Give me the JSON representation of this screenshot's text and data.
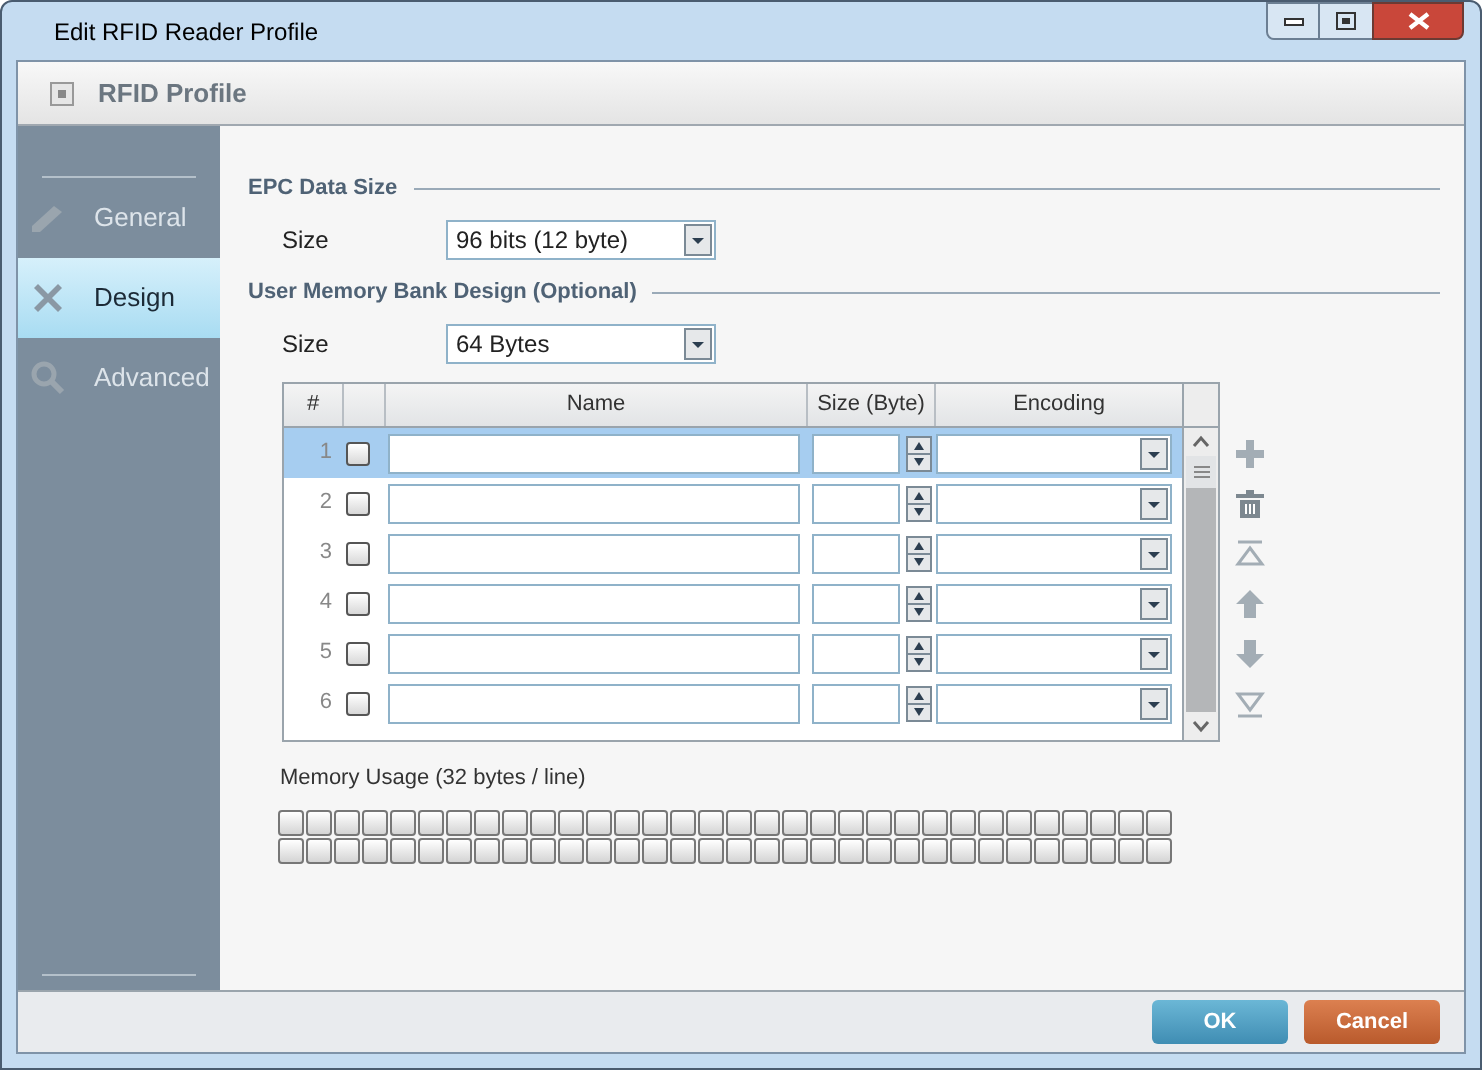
{
  "window": {
    "title": "Edit RFID Reader Profile"
  },
  "header": {
    "title": "RFID Profile"
  },
  "sidebar": {
    "items": [
      {
        "label": "General",
        "selected": false
      },
      {
        "label": "Design",
        "selected": true
      },
      {
        "label": "Advanced",
        "selected": false
      }
    ]
  },
  "epc_section": {
    "title": "EPC Data Size",
    "size_label": "Size",
    "size_value": "96 bits (12 byte)"
  },
  "user_memory_section": {
    "title": "User Memory Bank Design (Optional)",
    "size_label": "Size",
    "size_value": "64 Bytes"
  },
  "table": {
    "columns": [
      "#",
      "Name",
      "Size (Byte)",
      "Encoding"
    ],
    "rows": [
      {
        "number": "1",
        "checked": false,
        "selected": true
      },
      {
        "number": "2",
        "checked": false,
        "selected": false
      },
      {
        "number": "3",
        "checked": false,
        "selected": false
      },
      {
        "number": "4",
        "checked": false,
        "selected": false
      },
      {
        "number": "5",
        "checked": false,
        "selected": false
      },
      {
        "number": "6",
        "checked": false,
        "selected": false
      }
    ]
  },
  "memory_usage": {
    "label": "Memory Usage (32 bytes / line)"
  },
  "buttons": [
    {
      "label": "OK",
      "kind": "primary"
    },
    {
      "label": "Cancel",
      "kind": "cancel"
    }
  ]
}
